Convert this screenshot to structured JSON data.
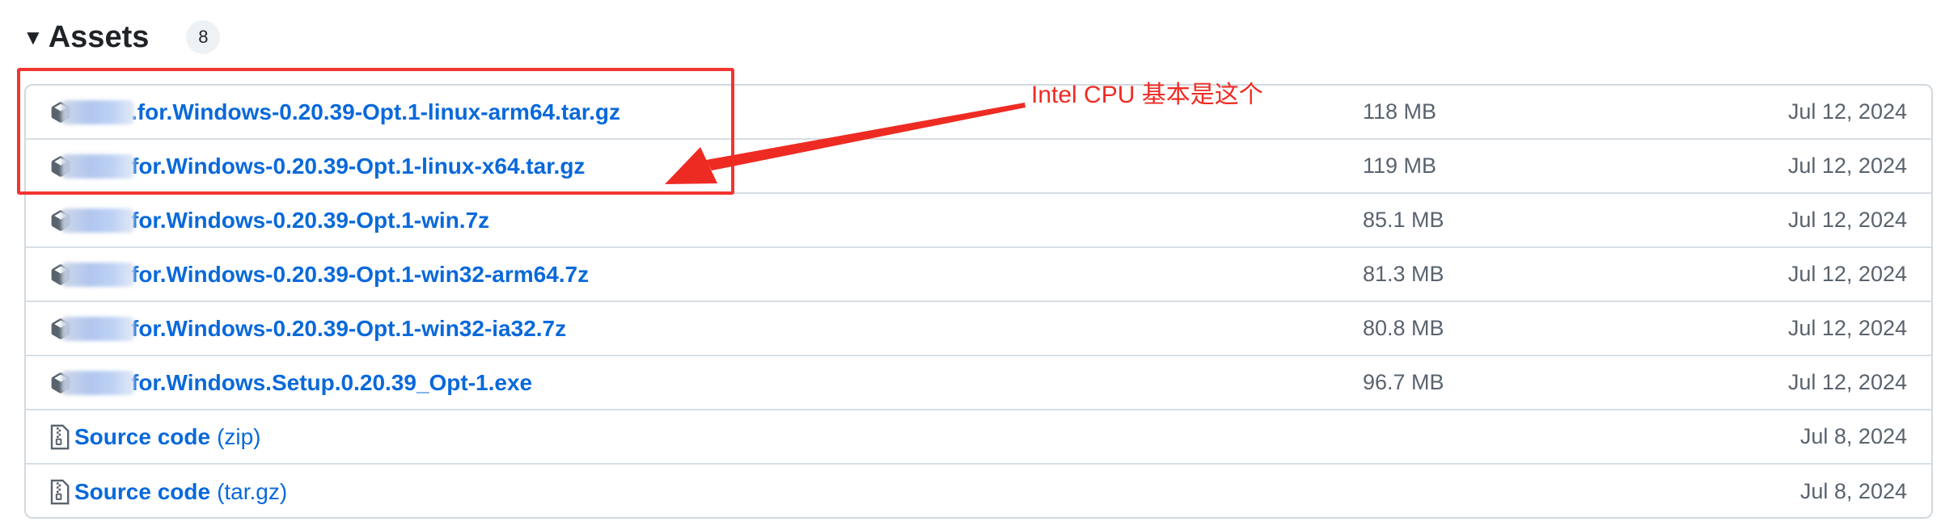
{
  "header": {
    "title": "Assets",
    "count": "8"
  },
  "assets": [
    {
      "name": ".for.Windows-0.20.39-Opt.1-linux-arm64.tar.gz",
      "size": "118 MB",
      "date": "Jul 12, 2024"
    },
    {
      "name": "for.Windows-0.20.39-Opt.1-linux-x64.tar.gz",
      "size": "119 MB",
      "date": "Jul 12, 2024"
    },
    {
      "name": "for.Windows-0.20.39-Opt.1-win.7z",
      "size": "85.1 MB",
      "date": "Jul 12, 2024"
    },
    {
      "name": "for.Windows-0.20.39-Opt.1-win32-arm64.7z",
      "size": "81.3 MB",
      "date": "Jul 12, 2024"
    },
    {
      "name": "for.Windows-0.20.39-Opt.1-win32-ia32.7z",
      "size": "80.8 MB",
      "date": "Jul 12, 2024"
    },
    {
      "name": "for.Windows.Setup.0.20.39_Opt-1.exe",
      "size": "96.7 MB",
      "date": "Jul 12, 2024"
    }
  ],
  "source": [
    {
      "label": "Source code",
      "suffix": "(zip)",
      "date": "Jul 8, 2024"
    },
    {
      "label": "Source code",
      "suffix": "(tar.gz)",
      "date": "Jul 8, 2024"
    }
  ],
  "annotation": {
    "text": "Intel CPU 基本是这个",
    "color": "#ee2b23"
  },
  "colors": {
    "link": "#0969da",
    "muted": "#59636e",
    "border": "#d1d9e0",
    "highlight": "#f2352f"
  },
  "icons": {
    "package": "package-icon",
    "zip": "file-zip-icon",
    "expand": "triangle-down-icon"
  }
}
